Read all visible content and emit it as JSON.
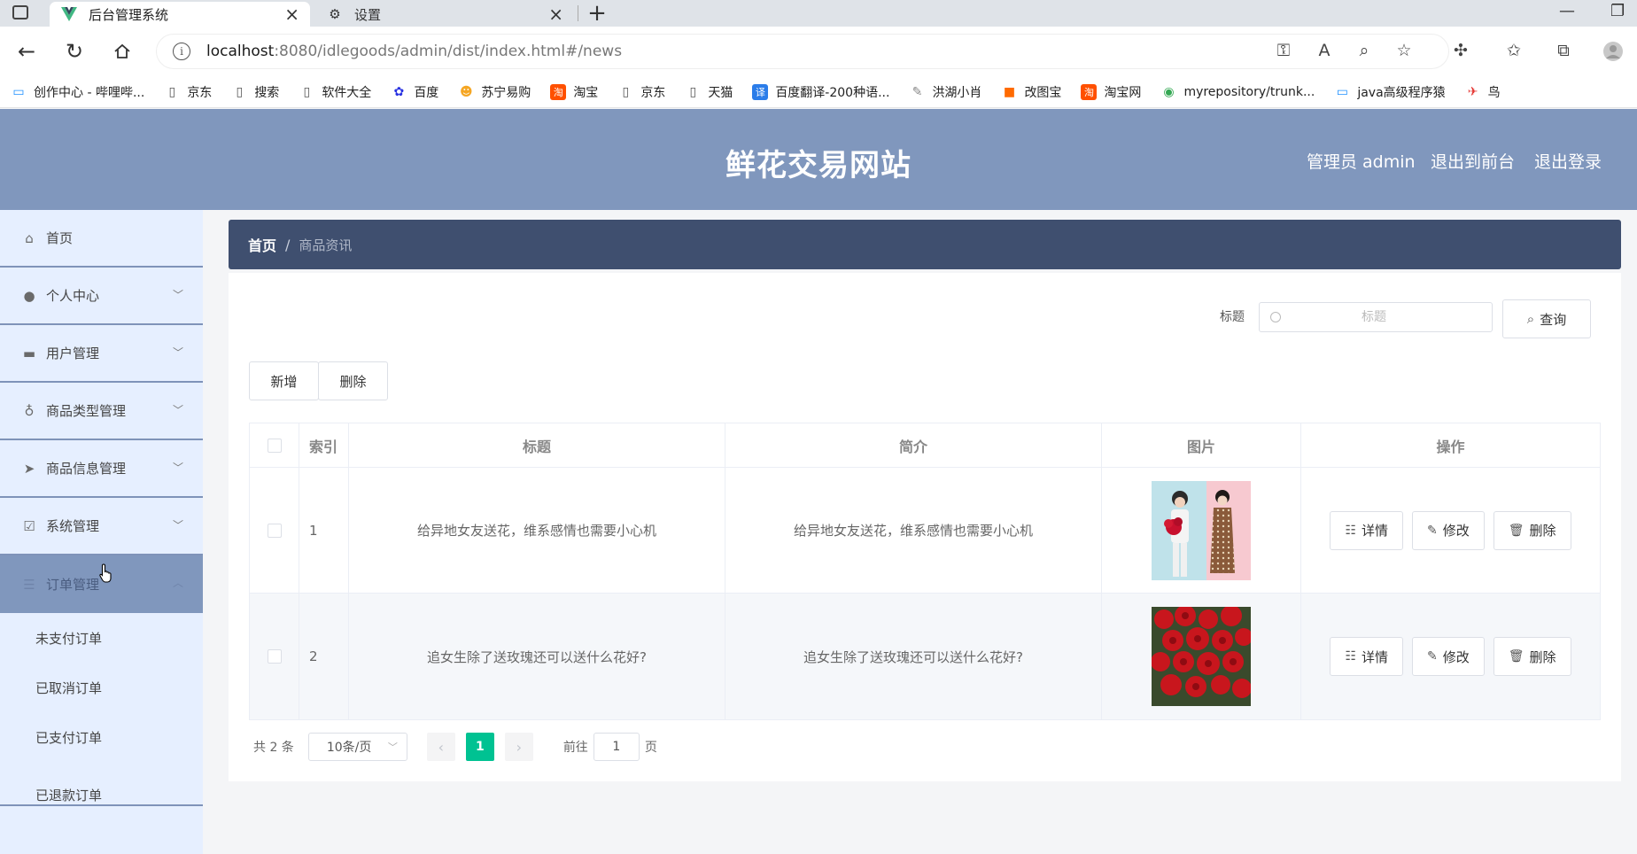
{
  "browser": {
    "tabs": [
      {
        "title": "后台管理系统",
        "active": true
      },
      {
        "title": "设置",
        "active": false
      }
    ],
    "url_host": "localhost",
    "url_path": ":8080/idlegoods/admin/dist/index.html#/news",
    "bookmarks": [
      {
        "label": "创作中心 - 哔哩哔...",
        "icon": "tv-icon",
        "color": "#1e90ff"
      },
      {
        "label": "京东",
        "icon": "page-icon",
        "color": "#555555"
      },
      {
        "label": "搜索",
        "icon": "page-icon",
        "color": "#555555"
      },
      {
        "label": "软件大全",
        "icon": "page-icon",
        "color": "#555555"
      },
      {
        "label": "百度",
        "icon": "paw-icon",
        "color": "#2932e1"
      },
      {
        "label": "苏宁易购",
        "icon": "lion-icon",
        "color": "#f5a623"
      },
      {
        "label": "淘宝",
        "icon": "taobao-icon",
        "color": "#ff5000"
      },
      {
        "label": "京东",
        "icon": "page-icon",
        "color": "#555555"
      },
      {
        "label": "天猫",
        "icon": "page-icon",
        "color": "#555555"
      },
      {
        "label": "百度翻译-200种语...",
        "icon": "translate-icon",
        "color": "#2b7de9"
      },
      {
        "label": "洪湖小肖",
        "icon": "feather-icon",
        "color": "#888888"
      },
      {
        "label": "改图宝",
        "icon": "square-icon",
        "color": "#ff6a00"
      },
      {
        "label": "淘宝网",
        "icon": "taobao-icon",
        "color": "#ff5000"
      },
      {
        "label": "myrepository/trunk...",
        "icon": "chrome-icon",
        "color": "#34a853"
      },
      {
        "label": "java高级程序猿",
        "icon": "tv-icon",
        "color": "#1e90ff"
      },
      {
        "label": "鸟",
        "icon": "bird-icon",
        "color": "#e53935"
      }
    ]
  },
  "header": {
    "site_title": "鲜花交易网站",
    "admin_label": "管理员 admin",
    "to_front": "退出到前台",
    "logout": "退出登录"
  },
  "sidebar": {
    "items": [
      {
        "label": "首页",
        "icon": "home-icon",
        "has_arrow": false
      },
      {
        "label": "个人中心",
        "icon": "user-icon",
        "has_arrow": true
      },
      {
        "label": "用户管理",
        "icon": "briefcase-icon",
        "has_arrow": true
      },
      {
        "label": "商品类型管理",
        "icon": "microphone-icon",
        "has_arrow": true
      },
      {
        "label": "商品信息管理",
        "icon": "send-icon",
        "has_arrow": true
      },
      {
        "label": "系统管理",
        "icon": "checkbox-icon",
        "has_arrow": true
      },
      {
        "label": "订单管理",
        "icon": "order-icon",
        "has_arrow": true
      }
    ],
    "sub_items": [
      "未支付订单",
      "已取消订单",
      "已支付订单",
      "已退款订单"
    ]
  },
  "breadcrumb": {
    "home": "首页",
    "separator": "/",
    "current": "商品资讯"
  },
  "search": {
    "label": "标题",
    "placeholder": "标题",
    "button": "查询"
  },
  "actions": {
    "add": "新增",
    "delete": "删除"
  },
  "table": {
    "headers": {
      "index": "索引",
      "title": "标题",
      "intro": "简介",
      "image": "图片",
      "operation": "操作"
    },
    "rows": [
      {
        "index": "1",
        "title": "给异地女友送花，维系感情也需要小心机",
        "intro": "给异地女友送花，维系感情也需要小心机",
        "image": "couple-flowers-photo"
      },
      {
        "index": "2",
        "title": "追女生除了送玫瑰还可以送什么花好?",
        "intro": "追女生除了送玫瑰还可以送什么花好?",
        "image": "red-roses-photo"
      }
    ],
    "row_actions": {
      "detail": "详情",
      "edit": "修改",
      "delete": "删除"
    }
  },
  "pagination": {
    "total": "共 2 条",
    "page_size": "10条/页",
    "current_page": "1",
    "goto_prefix": "前往",
    "goto_value": "1",
    "goto_suffix": "页"
  },
  "colors": {
    "header_bg": "#8097bd",
    "sidebar_bg": "#e6efff",
    "breadcrumb_bg": "#3f4f6f",
    "accent": "#00c292"
  }
}
